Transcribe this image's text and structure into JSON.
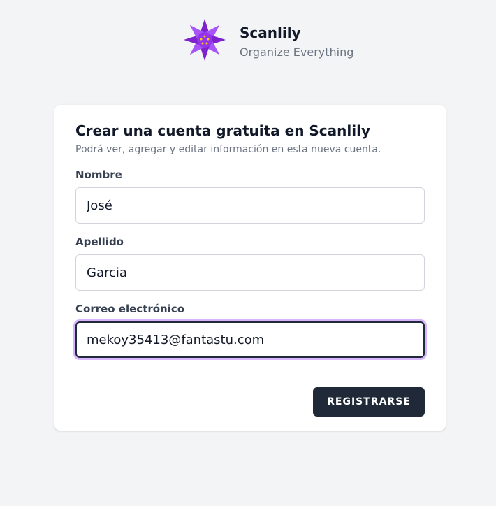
{
  "brand": {
    "name": "Scanlily",
    "tagline": "Organize Everything",
    "logo_icon": "lotus-flower-icon",
    "logo_colors": [
      "#7e22ce",
      "#a855f7",
      "#c084fc",
      "#facc15"
    ]
  },
  "form": {
    "title": "Crear una cuenta gratuita en Scanlily",
    "subtitle": "Podrá ver, agregar y editar información en esta nueva cuenta.",
    "first_name": {
      "label": "Nombre",
      "value": "José"
    },
    "last_name": {
      "label": "Apellido",
      "value": "Garcia"
    },
    "email": {
      "label": "Correo electrónico",
      "value": "mekoy35413@fantastu.com",
      "focused": true
    },
    "submit_label": "REGISTRARSE"
  },
  "colors": {
    "background": "#f3f4f6",
    "button": "#1f2937",
    "focus_ring": "#d8b4fe"
  }
}
